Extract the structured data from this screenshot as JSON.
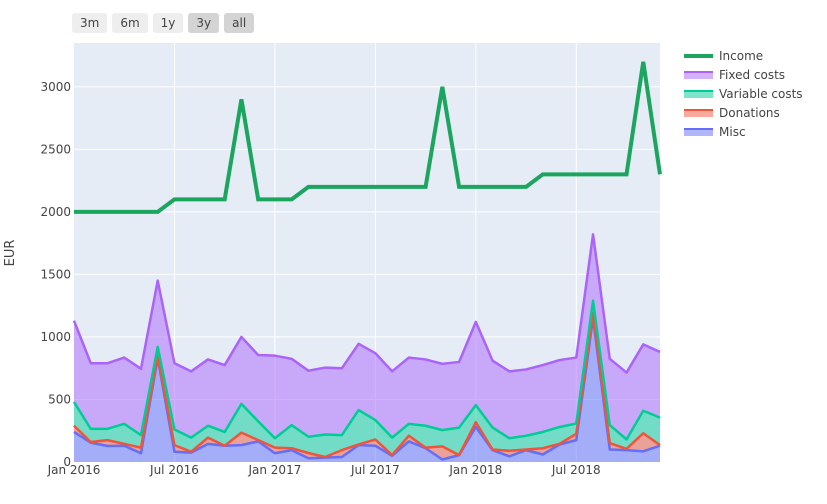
{
  "range_selector": {
    "buttons": [
      {
        "label": "3m",
        "active": false
      },
      {
        "label": "6m",
        "active": false
      },
      {
        "label": "1y",
        "active": false
      },
      {
        "label": "3y",
        "active": true
      },
      {
        "label": "all",
        "active": true
      }
    ]
  },
  "chart_data": {
    "type": "area",
    "title": "",
    "xlabel": "",
    "ylabel": "EUR",
    "ylim": [
      0,
      3350
    ],
    "xlim": [
      "2016-01",
      "2018-12"
    ],
    "grid": true,
    "legend_position": "right-top",
    "x_ticks": [
      "Jan 2016",
      "Jul 2016",
      "Jan 2017",
      "Jul 2017",
      "Jan 2018",
      "Jul 2018"
    ],
    "y_ticks": [
      0,
      500,
      1000,
      1500,
      2000,
      2500,
      3000
    ],
    "x": [
      "2016-01",
      "2016-02",
      "2016-03",
      "2016-04",
      "2016-05",
      "2016-06",
      "2016-07",
      "2016-08",
      "2016-09",
      "2016-10",
      "2016-11",
      "2016-12",
      "2017-01",
      "2017-02",
      "2017-03",
      "2017-04",
      "2017-05",
      "2017-06",
      "2017-07",
      "2017-08",
      "2017-09",
      "2017-10",
      "2017-11",
      "2017-12",
      "2018-01",
      "2018-02",
      "2018-03",
      "2018-04",
      "2018-05",
      "2018-06",
      "2018-07",
      "2018-08",
      "2018-09",
      "2018-10",
      "2018-11",
      "2018-12"
    ],
    "series": [
      {
        "name": "Income",
        "kind": "line",
        "color": "#1ba55f",
        "values": [
          2000,
          2000,
          2000,
          2000,
          2000,
          2000,
          2100,
          2100,
          2100,
          2100,
          2900,
          2100,
          2100,
          2100,
          2200,
          2200,
          2200,
          2200,
          2200,
          2200,
          2200,
          2200,
          3000,
          2200,
          2200,
          2200,
          2200,
          2200,
          2300,
          2300,
          2300,
          2300,
          2300,
          2300,
          3200,
          2300
        ]
      },
      {
        "name": "Fixed costs",
        "kind": "stacked-area",
        "color": "#ab63fa",
        "values": [
          650,
          525,
          525,
          530,
          530,
          530,
          530,
          530,
          530,
          535,
          535,
          530,
          660,
          530,
          528,
          535,
          535,
          530,
          535,
          530,
          530,
          530,
          530,
          525,
          665,
          535,
          535,
          530,
          535,
          535,
          527,
          530,
          530,
          535,
          530,
          525
        ]
      },
      {
        "name": "Variable costs",
        "kind": "stacked-area",
        "color": "#00cc96",
        "values": [
          190,
          105,
          90,
          160,
          100,
          70,
          125,
          113,
          95,
          110,
          230,
          150,
          75,
          185,
          130,
          180,
          120,
          275,
          155,
          140,
          95,
          175,
          130,
          220,
          137,
          175,
          100,
          110,
          130,
          135,
          83,
          100,
          145,
          75,
          180,
          220
        ]
      },
      {
        "name": "Donations",
        "kind": "stacked-area",
        "color": "#ef553b",
        "values": [
          50,
          5,
          47,
          15,
          45,
          20,
          53,
          7,
          50,
          0,
          100,
          10,
          45,
          15,
          42,
          5,
          55,
          5,
          50,
          5,
          45,
          5,
          105,
          0,
          38,
          5,
          45,
          5,
          50,
          5,
          50,
          40,
          50,
          10,
          145,
          5
        ]
      },
      {
        "name": "Misc",
        "kind": "stacked-area",
        "color": "#636efa",
        "values": [
          240,
          155,
          128,
          130,
          70,
          830,
          82,
          75,
          145,
          130,
          135,
          165,
          70,
          95,
          30,
          35,
          40,
          135,
          130,
          50,
          165,
          110,
          20,
          55,
          280,
          95,
          45,
          95,
          60,
          140,
          175,
          1150,
          100,
          95,
          85,
          130
        ]
      }
    ]
  }
}
